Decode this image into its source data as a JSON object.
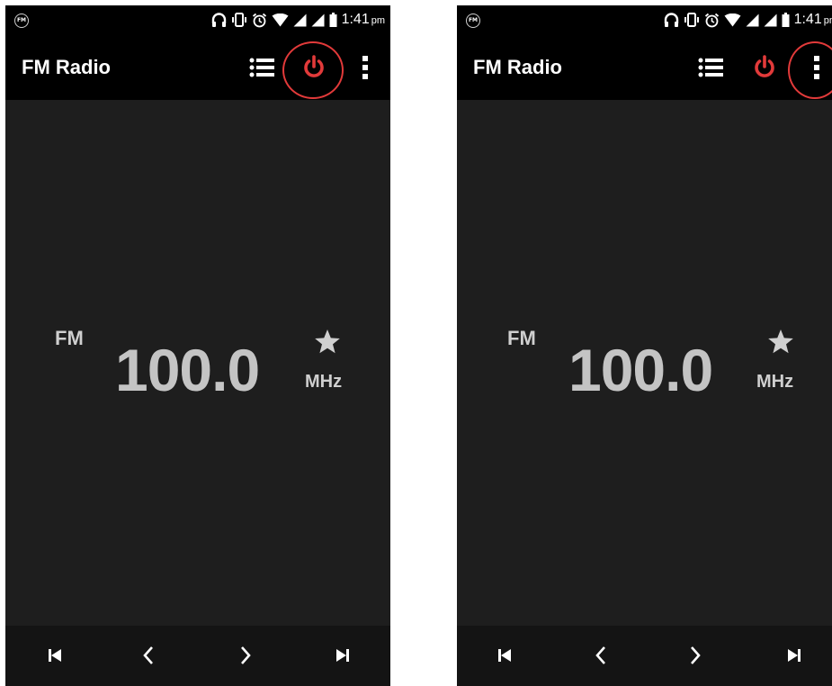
{
  "screens": [
    {
      "status": {
        "time": "1:41",
        "ampm": "pm",
        "fm_badge": "FM"
      },
      "app_title": "FM Radio",
      "tuner": {
        "band": "FM",
        "frequency": "100.0",
        "unit": "MHz"
      },
      "highlighted_action": "power"
    },
    {
      "status": {
        "time": "1:41",
        "ampm": "pm",
        "fm_badge": "FM"
      },
      "app_title": "FM Radio",
      "tuner": {
        "band": "FM",
        "frequency": "100.0",
        "unit": "MHz"
      },
      "highlighted_action": "more-options"
    }
  ],
  "colors": {
    "background": "#1e1e1e",
    "bars": "#000000",
    "bottom_bar": "#141414",
    "power_accent": "#e23a3a",
    "highlight_ring": "#e23a3a",
    "frequency_text": "#c4c4c4"
  },
  "icons": {
    "status": [
      "headphones-icon",
      "vibrate-icon",
      "alarm-icon",
      "wifi-icon",
      "signal-icon",
      "signal-icon",
      "battery-icon"
    ],
    "appbar": [
      "list-icon",
      "power-icon",
      "more-vert-icon"
    ],
    "tuner": [
      "star-icon"
    ],
    "bottombar": [
      "skip-previous-icon",
      "chevron-left-icon",
      "chevron-right-icon",
      "skip-next-icon"
    ]
  }
}
